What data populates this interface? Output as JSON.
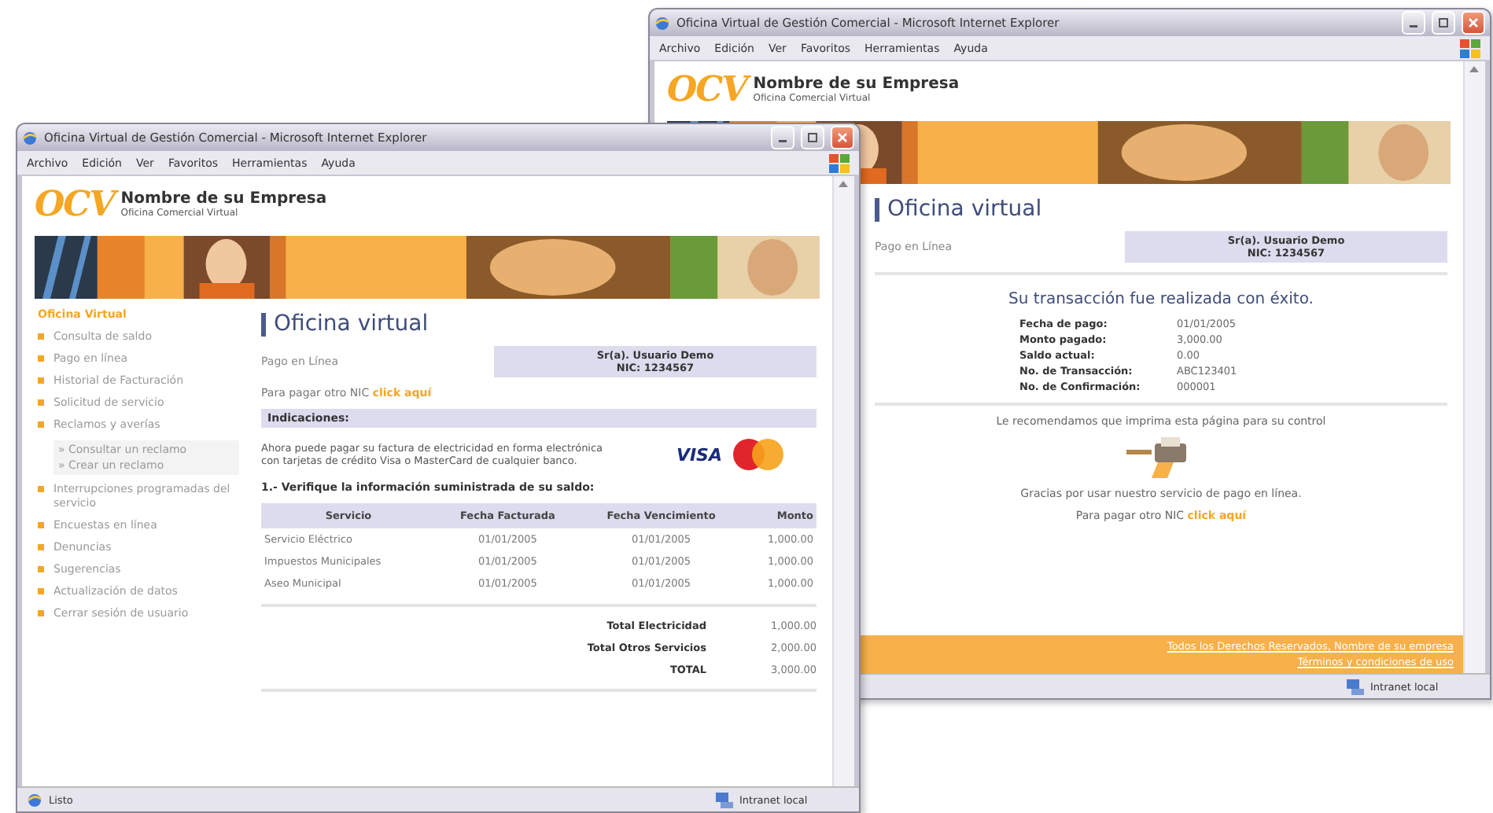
{
  "windows": [
    {
      "kind": "receipt",
      "title": "Oficina Virtual de Gestión Comercial - Microsoft Internet Explorer",
      "menu": [
        "Archivo",
        "Edición",
        "Ver",
        "Favoritos",
        "Herramientas",
        "Ayuda"
      ],
      "logo": {
        "mark": "OCV",
        "company": "Nombre de su Empresa",
        "subtitle": "Oficina Comercial Virtual"
      },
      "heading": "Oficina virtual",
      "section": "Pago en Línea",
      "customer": [
        "Sr(a). Usuario Demo",
        "NIC: 1234567"
      ],
      "message": "Su transacción fue realizada con éxito.",
      "details": [
        {
          "label": "Fecha de pago:",
          "value": "01/01/2005"
        },
        {
          "label": "Monto pagado:",
          "value": "3,000.00"
        },
        {
          "label": "Saldo actual:",
          "value": "0.00"
        },
        {
          "label": "No. de Transacción:",
          "value": "ABC123401"
        },
        {
          "label": "No. de Confirmación:",
          "value": "000001"
        }
      ],
      "recommendation": "Le recomendamos que imprima esta página para su control",
      "thanks": "Gracias por usar nuestro servicio de pago en línea.",
      "link_prefix": "Para pagar otro NIC",
      "link": "click aquí",
      "footer": [
        "Todos los Derechos Reservados, Nombre de su empresa",
        "Términos y condiciones de uso"
      ],
      "status": {
        "zone": "Intranet local"
      }
    },
    {
      "kind": "payment",
      "title": "Oficina Virtual de Gestión Comercial - Microsoft Internet Explorer",
      "menu": [
        "Archivo",
        "Edición",
        "Ver",
        "Favoritos",
        "Herramientas",
        "Ayuda"
      ],
      "logo": {
        "mark": "OCV",
        "company": "Nombre de su Empresa",
        "subtitle": "Oficina Comercial Virtual"
      },
      "sidebar": [
        {
          "label": "Oficina Virtual",
          "selected": true
        },
        {
          "label": "Consulta de saldo",
          "selected": false
        },
        {
          "label": "Pago en línea",
          "selected": false
        },
        {
          "label": "Historial de Facturación",
          "selected": false
        },
        {
          "label": "Solicitud de servicio",
          "selected": false
        },
        {
          "label": "Reclamos y averías",
          "selected": false,
          "children": [
            {
              "label": "» Consultar un reclamo",
              "selected": false
            },
            {
              "label": "» Crear un reclamo",
              "selected": false
            }
          ]
        },
        {
          "label": "Interrupciones programadas del servicio",
          "selected": false
        },
        {
          "label": "Encuestas en línea",
          "selected": false
        },
        {
          "label": "Denuncias",
          "selected": false
        },
        {
          "label": "Sugerencias",
          "selected": false
        },
        {
          "label": "Actualización de datos",
          "selected": false
        },
        {
          "label": "Cerrar sesión de usuario",
          "selected": false
        }
      ],
      "heading": "Oficina virtual",
      "section": "Pago en Línea",
      "customer": [
        "Sr(a). Usuario Demo",
        "NIC: 1234567"
      ],
      "link_prefix": "Para pagar otro NIC",
      "link": "click aquí",
      "notice_title": "Indicaciones:",
      "notice": "Ahora puede pagar su factura de electricidad en forma electrónica con tarjetas de crédito Visa o MasterCard de cualquier banco.",
      "card_brand": "VISA",
      "step": "1.- Verifique la información suministrada de su saldo:",
      "table": {
        "columns": [
          "Servicio",
          "Fecha Facturada",
          "Fecha Vencimiento",
          "Monto"
        ],
        "rows": [
          [
            "Servicio Eléctrico",
            "01/01/2005",
            "01/01/2005",
            "1,000.00"
          ],
          [
            "Impuestos Municipales",
            "01/01/2005",
            "01/01/2005",
            "1,000.00"
          ],
          [
            "Aseo Municipal",
            "01/01/2005",
            "01/01/2005",
            "1,000.00"
          ]
        ]
      },
      "totals": [
        {
          "label": "Total Electricidad",
          "value": "1,000.00"
        },
        {
          "label": "Total Otros Servicios",
          "value": "2,000.00"
        },
        {
          "label": "TOTAL",
          "value": "3,000.00"
        }
      ],
      "status": {
        "text": "Listo",
        "zone": "Intranet local"
      }
    }
  ]
}
